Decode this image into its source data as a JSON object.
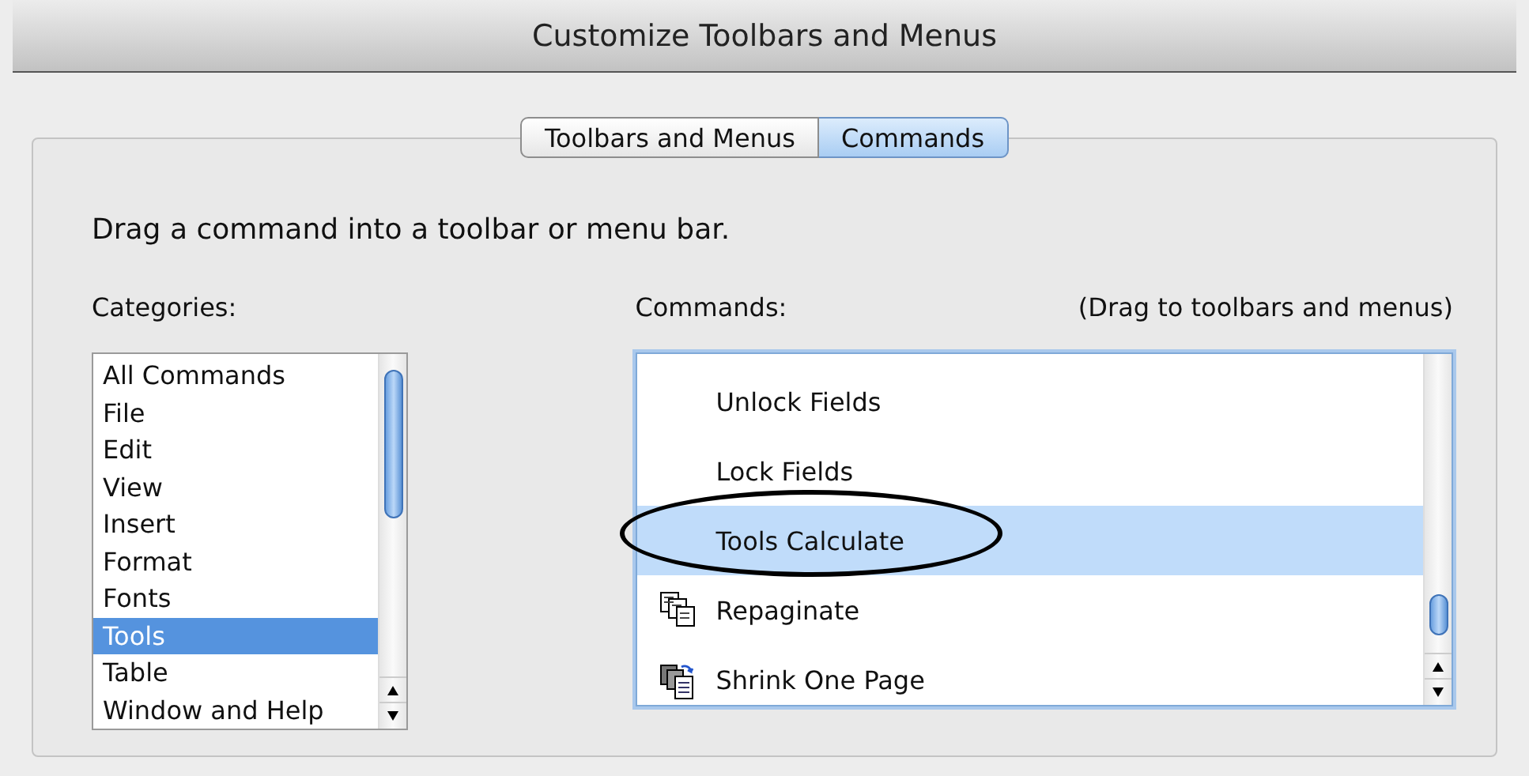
{
  "window": {
    "title": "Customize Toolbars and Menus"
  },
  "tabs": [
    {
      "label": "Toolbars and Menus",
      "selected": false
    },
    {
      "label": "Commands",
      "selected": true
    }
  ],
  "instruction": "Drag a command into a toolbar or menu bar.",
  "categories": {
    "label": "Categories:",
    "items": [
      {
        "label": "All Commands",
        "selected": false
      },
      {
        "label": "File",
        "selected": false
      },
      {
        "label": "Edit",
        "selected": false
      },
      {
        "label": "View",
        "selected": false
      },
      {
        "label": "Insert",
        "selected": false
      },
      {
        "label": "Format",
        "selected": false
      },
      {
        "label": "Fonts",
        "selected": false
      },
      {
        "label": "Tools",
        "selected": true
      },
      {
        "label": "Table",
        "selected": false
      },
      {
        "label": "Window and Help",
        "selected": false
      }
    ]
  },
  "commands": {
    "label": "Commands:",
    "hint": "(Drag to toolbars and menus)",
    "items": [
      {
        "label": "Unlock Fields",
        "kind": "plain",
        "selected": false
      },
      {
        "label": "Lock Fields",
        "kind": "plain",
        "selected": false
      },
      {
        "label": "Tools Calculate",
        "kind": "plain",
        "selected": true
      },
      {
        "label": "Repaginate",
        "kind": "pages",
        "selected": false
      },
      {
        "label": "Shrink One Page",
        "kind": "shrink",
        "selected": false
      }
    ]
  }
}
